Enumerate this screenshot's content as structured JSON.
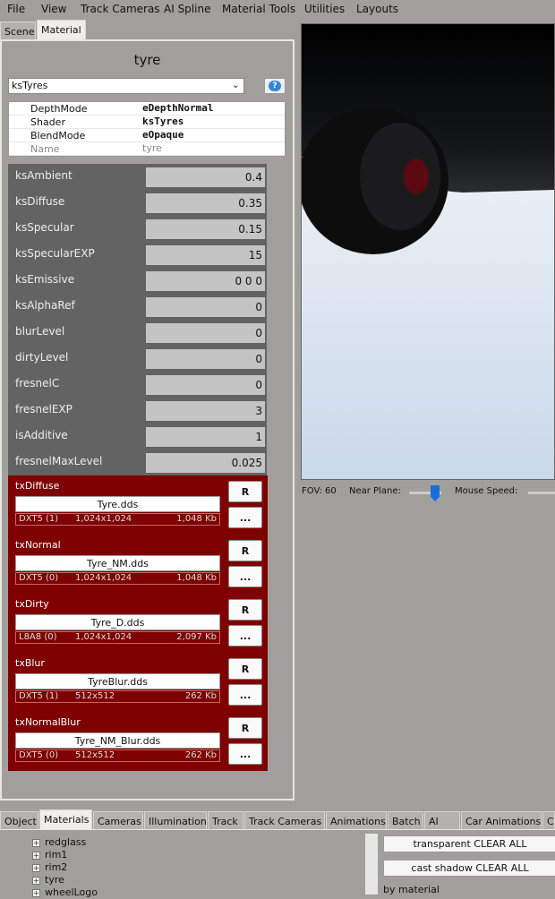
{
  "menu": [
    "File",
    "View",
    "Track Cameras",
    "AI Spline",
    "Material Tools",
    "Utilities",
    "Layouts"
  ],
  "top_tabs": [
    "Scene",
    "Material"
  ],
  "material": {
    "title": "tyre",
    "shader_select": "ksTyres",
    "props": [
      {
        "key": "DepthMode",
        "value": "eDepthNormal"
      },
      {
        "key": "Shader",
        "value": "ksTyres"
      },
      {
        "key": "BlendMode",
        "value": "eOpaque"
      },
      {
        "key": "Name",
        "value": "tyre"
      }
    ],
    "params": [
      {
        "label": "ksAmbient",
        "value": "0.4"
      },
      {
        "label": "ksDiffuse",
        "value": "0.35"
      },
      {
        "label": "ksSpecular",
        "value": "0.15"
      },
      {
        "label": "ksSpecularEXP",
        "value": "15"
      },
      {
        "label": "ksEmissive",
        "value": "0 0 0"
      },
      {
        "label": "ksAlphaRef",
        "value": "0"
      },
      {
        "label": "blurLevel",
        "value": "0"
      },
      {
        "label": "dirtyLevel",
        "value": "0"
      },
      {
        "label": "fresnelC",
        "value": "0"
      },
      {
        "label": "fresnelEXP",
        "value": "3"
      },
      {
        "label": "isAdditive",
        "value": "1"
      },
      {
        "label": "fresnelMaxLevel",
        "value": "0.025"
      }
    ],
    "textures": [
      {
        "slot": "txDiffuse",
        "file": "Tyre.dds",
        "format": "DXT5 (1)",
        "dims": "1,024x1,024",
        "size": "1,048 Kb"
      },
      {
        "slot": "txNormal",
        "file": "Tyre_NM.dds",
        "format": "DXT5 (0)",
        "dims": "1,024x1,024",
        "size": "1,048 Kb"
      },
      {
        "slot": "txDirty",
        "file": "Tyre_D.dds",
        "format": "L8A8 (0)",
        "dims": "1,024x1,024",
        "size": "2,097 Kb"
      },
      {
        "slot": "txBlur",
        "file": "TyreBlur.dds",
        "format": "DXT5 (1)",
        "dims": "512x512",
        "size": "262 Kb"
      },
      {
        "slot": "txNormalBlur",
        "file": "Tyre_NM_Blur.dds",
        "format": "DXT5 (0)",
        "dims": "512x512",
        "size": "262 Kb"
      }
    ],
    "reload_label": "R",
    "browse_label": "..."
  },
  "viewport": {
    "fov": "FOV: 60",
    "near_plane_label": "Near Plane:",
    "mouse_speed_label": "Mouse Speed:"
  },
  "bottom_tabs": [
    "Object",
    "Materials",
    "Cameras",
    "Illumination",
    "Track",
    "Track Cameras",
    "Animations",
    "Batch",
    "AI",
    "Car Animations",
    "C"
  ],
  "tree": [
    "redglass",
    "rim1",
    "rim2",
    "tyre",
    "wheelLogo"
  ],
  "bottom_buttons": {
    "transparent_clear": "transparent CLEAR ALL",
    "cast_shadow_clear": "cast shadow CLEAR ALL",
    "by_material": "by material"
  }
}
